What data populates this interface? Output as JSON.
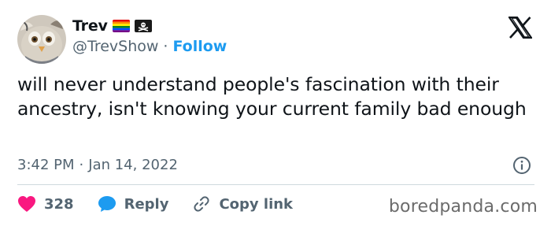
{
  "author": {
    "display_name": "Trev",
    "handle": "@TrevShow",
    "separator": "·",
    "follow_label": "Follow",
    "avatar_icon": "furby-avatar-icon",
    "badges": [
      "rainbow-flag-icon",
      "pirate-flag-icon"
    ]
  },
  "tweet": {
    "text": "will never understand people's fascination with their ancestry, isn't knowing your current family bad enough",
    "time": "3:42 PM",
    "separator": "·",
    "date": "Jan 14, 2022"
  },
  "actions": {
    "like_count": "328",
    "reply_label": "Reply",
    "copy_label": "Copy link"
  },
  "watermark": "boredpanda.com",
  "colors": {
    "link": "#1d9bf0",
    "like": "#f91880",
    "secondary_text": "#536471",
    "divider": "#cfd9de"
  }
}
